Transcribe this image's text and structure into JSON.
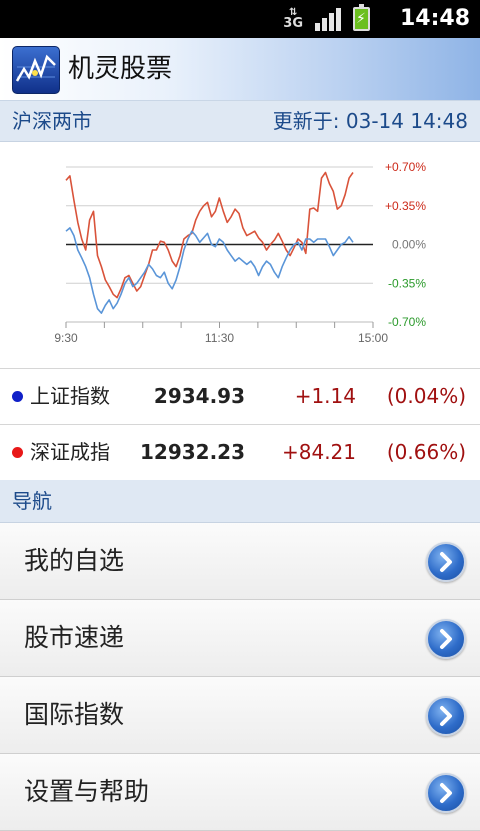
{
  "status_bar": {
    "network": "3G",
    "time": "14:48"
  },
  "app": {
    "title": "机灵股票"
  },
  "market": {
    "region": "沪深两市",
    "updated": "更新于: 03-14 14:48"
  },
  "chart_data": {
    "type": "line",
    "x_ticks": [
      "9:30",
      "11:30",
      "15:00"
    ],
    "y_ticks": [
      "+0.70%",
      "+0.35%",
      "0.00%",
      "-0.35%",
      "-0.70%"
    ],
    "ylim": [
      -0.7,
      0.7
    ],
    "x_points": 74,
    "series": [
      {
        "name": "深证成指",
        "color": "#d9533a",
        "values": [
          0.58,
          0.62,
          0.4,
          0.2,
          0.05,
          -0.05,
          0.22,
          0.3,
          -0.1,
          -0.2,
          -0.32,
          -0.38,
          -0.45,
          -0.48,
          -0.4,
          -0.3,
          -0.28,
          -0.35,
          -0.42,
          -0.38,
          -0.28,
          -0.18,
          -0.05,
          -0.05,
          0.03,
          0.02,
          -0.05,
          -0.15,
          -0.2,
          -0.1,
          0.05,
          0.08,
          0.1,
          0.22,
          0.3,
          0.35,
          0.38,
          0.25,
          0.3,
          0.42,
          0.3,
          0.2,
          0.25,
          0.32,
          0.28,
          0.15,
          0.08,
          0.1,
          0.12,
          0.06,
          0.02,
          -0.05,
          0.0,
          0.04,
          0.1,
          0.03,
          -0.05,
          -0.1,
          -0.03,
          0.05,
          0.02,
          -0.08,
          0.32,
          0.33,
          0.3,
          0.6,
          0.65,
          0.55,
          0.48,
          0.32,
          0.35,
          0.45,
          0.6,
          0.65
        ]
      },
      {
        "name": "上证指数",
        "color": "#5a95d8",
        "values": [
          0.12,
          0.15,
          0.08,
          -0.05,
          -0.12,
          -0.2,
          -0.3,
          -0.45,
          -0.58,
          -0.62,
          -0.55,
          -0.5,
          -0.58,
          -0.53,
          -0.45,
          -0.35,
          -0.3,
          -0.38,
          -0.35,
          -0.3,
          -0.25,
          -0.18,
          -0.22,
          -0.28,
          -0.3,
          -0.25,
          -0.35,
          -0.4,
          -0.32,
          -0.2,
          -0.05,
          0.05,
          0.12,
          0.08,
          0.02,
          0.06,
          0.1,
          0.0,
          -0.02,
          0.05,
          0.02,
          -0.05,
          -0.1,
          -0.15,
          -0.12,
          -0.15,
          -0.18,
          -0.15,
          -0.2,
          -0.28,
          -0.2,
          -0.15,
          -0.18,
          -0.25,
          -0.3,
          -0.2,
          -0.12,
          -0.05,
          0.0,
          0.02,
          -0.05,
          0.05,
          0.05,
          0.02,
          0.05,
          0.05,
          0.05,
          -0.02,
          -0.1,
          -0.05,
          0.0,
          0.02,
          0.07,
          0.02
        ]
      }
    ]
  },
  "indices": [
    {
      "name": "上证指数",
      "value": "2934.93",
      "change": "+1.14",
      "pct": "(0.04%)",
      "dot_color": "#1020c8"
    },
    {
      "name": "深证成指",
      "value": "12932.23",
      "change": "+84.21",
      "pct": "(0.66%)",
      "dot_color": "#e81818"
    }
  ],
  "nav": {
    "header": "导航",
    "items": [
      {
        "label": "我的自选",
        "icon": "arrow-right-icon"
      },
      {
        "label": "股市速递",
        "icon": "arrow-right-icon"
      },
      {
        "label": "国际指数",
        "icon": "arrow-right-icon"
      },
      {
        "label": "设置与帮助",
        "icon": "arrow-right-icon"
      }
    ]
  }
}
